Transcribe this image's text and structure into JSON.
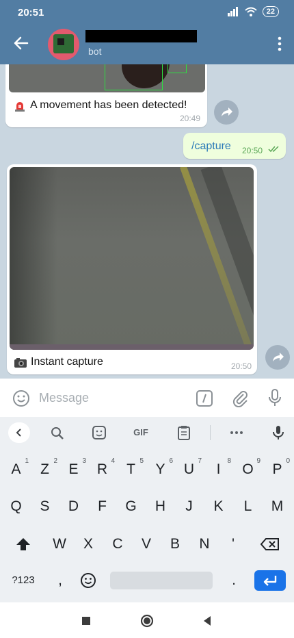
{
  "status_bar": {
    "time": "20:51",
    "battery": "22"
  },
  "header": {
    "subtitle": "bot"
  },
  "messages": [
    {
      "text": "A movement has been detected!",
      "time": "20:49"
    },
    {
      "text": "/capture",
      "time": "20:50"
    },
    {
      "text": "Instant capture",
      "time": "20:50"
    }
  ],
  "composer": {
    "placeholder": "Message"
  },
  "keyboard": {
    "toolbar": {
      "gif": "GIF"
    },
    "row1": [
      {
        "k": "A",
        "n": "1"
      },
      {
        "k": "Z",
        "n": "2"
      },
      {
        "k": "E",
        "n": "3"
      },
      {
        "k": "R",
        "n": "4"
      },
      {
        "k": "T",
        "n": "5"
      },
      {
        "k": "Y",
        "n": "6"
      },
      {
        "k": "U",
        "n": "7"
      },
      {
        "k": "I",
        "n": "8"
      },
      {
        "k": "O",
        "n": "9"
      },
      {
        "k": "P",
        "n": "0"
      }
    ],
    "row2": [
      "Q",
      "S",
      "D",
      "F",
      "G",
      "H",
      "J",
      "K",
      "L",
      "M"
    ],
    "row3": [
      "W",
      "X",
      "C",
      "V",
      "B",
      "N",
      "'"
    ],
    "sym_key": "?123",
    "comma": ",",
    "period": "."
  },
  "colors": {
    "header": "#527da3",
    "outgoing_bubble": "#effedd",
    "enter_key": "#1a73e8"
  }
}
